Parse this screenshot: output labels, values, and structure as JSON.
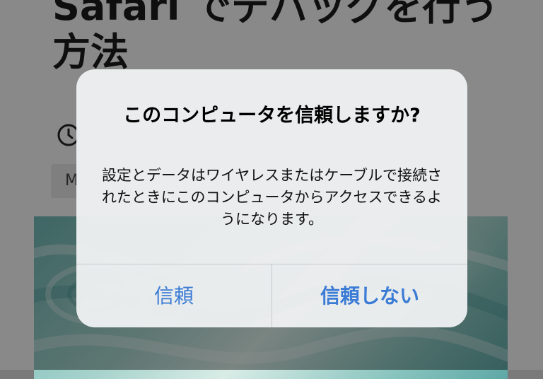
{
  "article": {
    "title": "Safari でデバッグを行う方法",
    "meta_chip_text": "M"
  },
  "icons": {
    "clock": "clock-icon"
  },
  "alert": {
    "title": "このコンピュータを信頼しますか?",
    "message": "設定とデータはワイヤレスまたはケーブルで接続されたときにこのコンピュータからアクセスできるようになります。",
    "buttons": {
      "trust": "信頼",
      "dont_trust": "信頼しない"
    }
  },
  "colors": {
    "button_text": "#3a7bd5",
    "dialog_background": "#eef0f1",
    "dim_overlay": "rgba(0,0,0,0.44)"
  }
}
